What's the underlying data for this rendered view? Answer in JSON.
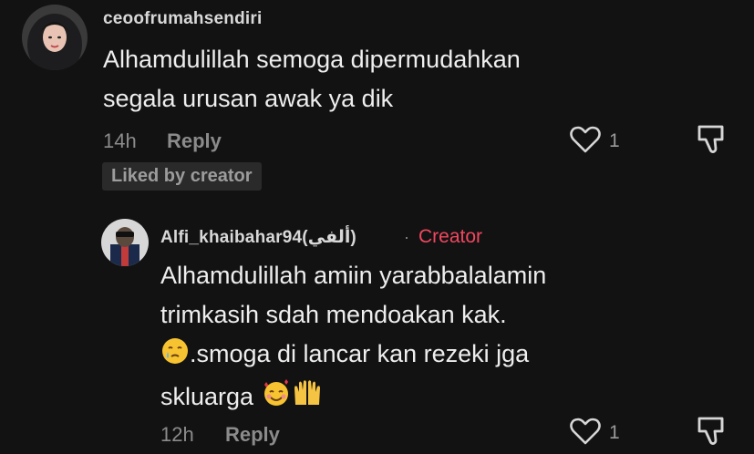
{
  "comment": {
    "username": "ceoofrumahsendiri",
    "lines": [
      "Alhamdulillah semoga dipermudahkan",
      "segala urusan awak ya dik"
    ],
    "time": "14h",
    "reply_label": "Reply",
    "like_count": "1",
    "liked_badge": "Liked by creator"
  },
  "reply": {
    "username": "Alfi_khaibahar94(ألفي)",
    "separator": "·",
    "creator_label": "Creator",
    "line1": "Alhamdulillah amiin yarabbalalamin",
    "line2": "trimkasih sdah mendoakan kak.",
    "line3_text": ".smoga di lancar kan rezeki jga",
    "line4_text": "skluarga",
    "emojis": [
      "face-holding-back-tears",
      "smiling-face-with-hearts",
      "raising-hands"
    ],
    "time": "12h",
    "reply_label": "Reply",
    "like_count": "1"
  },
  "colors": {
    "background": "#121212",
    "creator": "#f0475f",
    "secondary_text": "#8b8b8b"
  },
  "icons": [
    "heart-outline-icon",
    "dislike-icon"
  ]
}
